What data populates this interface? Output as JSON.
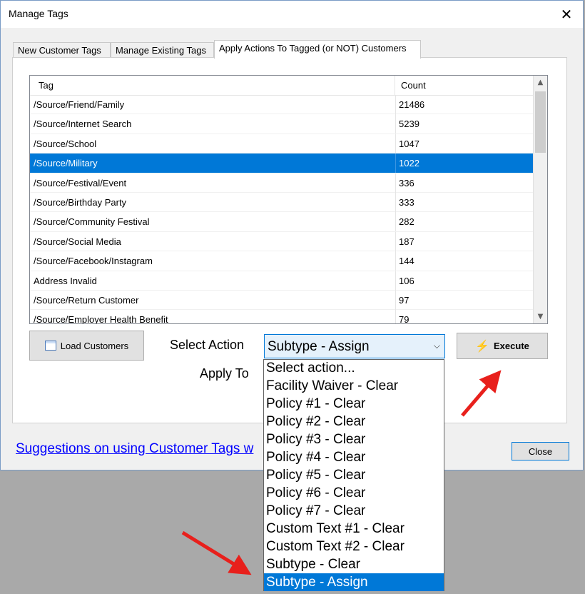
{
  "window": {
    "title": "Manage Tags",
    "close_glyph": "✕"
  },
  "tabs": [
    {
      "label": "New Customer Tags"
    },
    {
      "label": "Manage Existing Tags"
    },
    {
      "label": "Apply Actions To Tagged (or NOT) Customers"
    }
  ],
  "grid": {
    "headers": {
      "tag": "Tag",
      "count": "Count"
    },
    "rows": [
      {
        "tag": "/Source/Friend/Family",
        "count": "21486"
      },
      {
        "tag": "/Source/Internet Search",
        "count": "5239"
      },
      {
        "tag": "/Source/School",
        "count": "1047"
      },
      {
        "tag": "/Source/Military",
        "count": "1022"
      },
      {
        "tag": "/Source/Festival/Event",
        "count": "336"
      },
      {
        "tag": "/Source/Birthday Party",
        "count": "333"
      },
      {
        "tag": "/Source/Community Festival",
        "count": "282"
      },
      {
        "tag": "/Source/Social Media",
        "count": "187"
      },
      {
        "tag": "/Source/Facebook/Instagram",
        "count": "144"
      },
      {
        "tag": "Address Invalid",
        "count": "106"
      },
      {
        "tag": "/Source/Return Customer",
        "count": "97"
      },
      {
        "tag": "/Source/Employer Health Benefit",
        "count": "79"
      }
    ],
    "selected_row": 3
  },
  "buttons": {
    "load_customers": "Load Customers",
    "execute": "Execute",
    "close": "Close"
  },
  "labels": {
    "select_action": "Select Action",
    "apply_to": "Apply To"
  },
  "select_action": {
    "value": "Subtype - Assign",
    "options": [
      "Select action...",
      "Facility Waiver - Clear",
      "Policy #1 - Clear",
      "Policy #2 - Clear",
      "Policy #3 - Clear",
      "Policy #4 - Clear",
      "Policy #5 - Clear",
      "Policy #6 - Clear",
      "Policy #7 - Clear",
      "Custom Text #1 - Clear",
      "Custom Text #2 - Clear",
      "Subtype - Clear",
      "Subtype - Assign"
    ],
    "highlighted_index": 12
  },
  "help_link": "Suggestions on using Customer Tags w",
  "colors": {
    "selection": "#0078d7",
    "link": "#0000ff",
    "annotation_arrow": "#e8201c"
  }
}
